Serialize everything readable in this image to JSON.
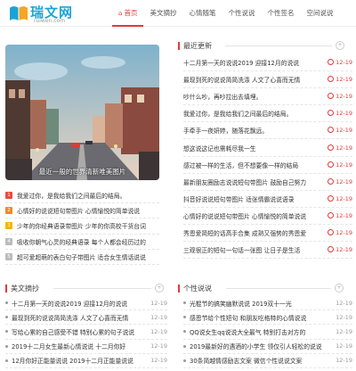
{
  "logo": {
    "cn": "瑞文网",
    "en": "ruiwen.com"
  },
  "nav": [
    {
      "label": "首页",
      "icon": "home-icon"
    },
    {
      "label": "美文摘抄"
    },
    {
      "label": "心情随笔"
    },
    {
      "label": "个性说说"
    },
    {
      "label": "个性签名"
    },
    {
      "label": "空间说说"
    }
  ],
  "hero": {
    "caption": "最近一般的世界清新唯美图片"
  },
  "left_list": [
    {
      "num": "1",
      "text": "我爱过你，是我给我们之间最后的结局。"
    },
    {
      "num": "2",
      "text": "心情好的说说短句带图片 心情愉悦的简单说说"
    },
    {
      "num": "3",
      "text": "少年的你经典语录带图片 少年的你高校干货台词"
    },
    {
      "num": "4",
      "text": "吸收你朝气心灵的经典语录 每个人都会经历过的"
    },
    {
      "num": "5",
      "text": "超可爱超萌的表白句子带图片 适合女生情话说说"
    }
  ],
  "recent": {
    "title": "最近更新",
    "items": [
      {
        "text": "十二月第一天的说说2019 迎接12月的说说",
        "date": "12-19"
      },
      {
        "text": "最现到死的说说简简洗涤 人文了心喜而无情",
        "date": "12-19"
      },
      {
        "text": "吵什么吵，再吵拉出去填埋。",
        "date": "12-19"
      },
      {
        "text": "我爱过你，是我给我们之间最后的结局。",
        "date": "12-19"
      },
      {
        "text": "手牵手一夜妍婷，随落花飘远。",
        "date": "12-19"
      },
      {
        "text": "想这说这记也需耗尽我一生",
        "date": "12-19"
      },
      {
        "text": "感过被一样的生活，但不想要像一样的结局",
        "date": "12-19"
      },
      {
        "text": "最新朋友圈励志说说短句带图片 鼓励自己努力",
        "date": "12-19"
      },
      {
        "text": "抖音好说说短句带图片 适张情霸说说语录",
        "date": "12-19"
      },
      {
        "text": "心情好的说说短句带图片 心情愉悦的简单说说",
        "date": "12-19"
      },
      {
        "text": "秀恩爱简短的话高手合集 成熟又强势的秀恩爱",
        "date": "12-19"
      },
      {
        "text": "三观很正的短句一句话一张图 让日子是生活",
        "date": "12-19"
      }
    ]
  },
  "meiwen": {
    "title": "美文摘抄",
    "items": [
      {
        "text": "十二月第一天的说说2019 迎接12月的说说",
        "date": "12-19"
      },
      {
        "text": "最现到死的说说简简洗涤 人文了心喜而无情",
        "date": "12-19"
      },
      {
        "text": "写给心累的自己感受不错 特别心累的句子说说",
        "date": "12-19"
      },
      {
        "text": "2019十二月女生最新心情说说 十二月你好",
        "date": "12-19"
      },
      {
        "text": "12月你好正能量说说 2019十二月正能量说说",
        "date": "12-19"
      }
    ]
  },
  "gexing": {
    "title": "个性说说",
    "items": [
      {
        "text": "光棍节的搞笑幽默说说 2019双十一光",
        "date": "12-19"
      },
      {
        "text": "感恩节给个性短句 和朋友吃格特的心情说说",
        "date": "12-19"
      },
      {
        "text": "QQ说女生qq说说大全最气 特别打击对方的",
        "date": "12-19"
      },
      {
        "text": "2019最新好的遇酒的小学生 领仅引人轻松的说说",
        "date": "12-19"
      },
      {
        "text": "30条简越情感励志文案 微信个性说说文案",
        "date": "12-19"
      }
    ]
  }
}
